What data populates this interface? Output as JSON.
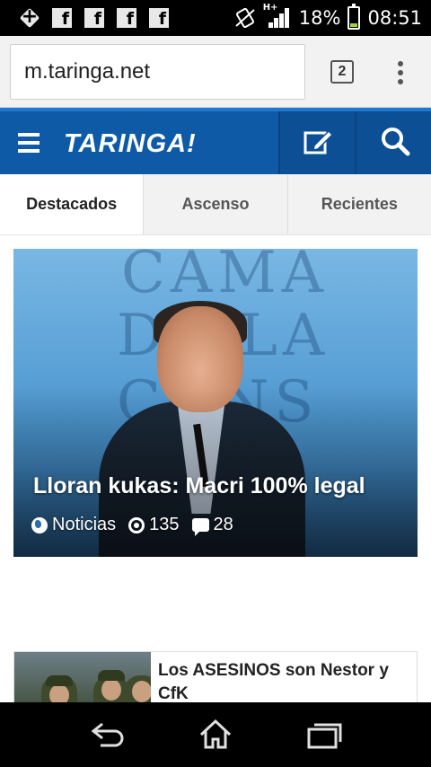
{
  "status_bar": {
    "notification_icons": [
      "add-icon",
      "facebook-icon",
      "facebook-icon",
      "facebook-icon",
      "facebook-icon",
      "facebook-icon"
    ],
    "network_type": "H+",
    "battery_percent": "18%",
    "time": "08:51"
  },
  "browser": {
    "url": "m.taringa.net",
    "tab_count": "2"
  },
  "header": {
    "logo": "TARINGA!"
  },
  "tabs": [
    {
      "label": "Destacados",
      "active": true
    },
    {
      "label": "Ascenso",
      "active": false
    },
    {
      "label": "Recientes",
      "active": false
    }
  ],
  "featured_post": {
    "title": "Lloran kukas: Macri 100% legal",
    "category": "Noticias",
    "views": "135",
    "comments": "28"
  },
  "posts": [
    {
      "title": "Los ASESINOS son Nestor y CfK"
    }
  ],
  "colors": {
    "header_blue": "#0e5aa7",
    "header_accent": "#1e78cf"
  }
}
